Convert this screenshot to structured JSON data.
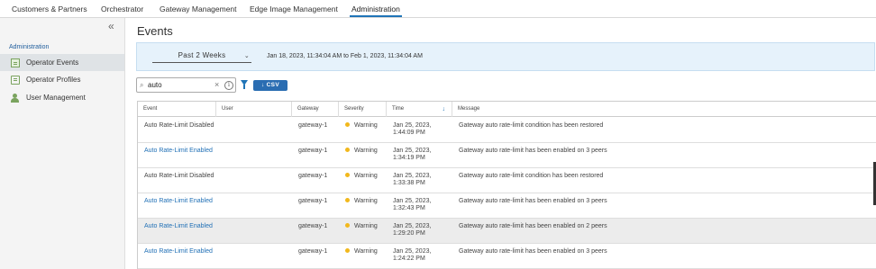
{
  "nav": {
    "tabs": [
      {
        "label": "Customers & Partners"
      },
      {
        "label": "Orchestrator"
      },
      {
        "label": "Gateway Management"
      },
      {
        "label": "Edge Image Management"
      },
      {
        "label": "Administration"
      }
    ],
    "active_tab": "Administration"
  },
  "sidebar": {
    "collapse_icon": "«",
    "section_label": "Administration",
    "items": [
      {
        "label": "Operator Events",
        "icon": "events-icon",
        "active": true
      },
      {
        "label": "Operator Profiles",
        "icon": "profiles-icon",
        "active": false
      },
      {
        "label": "User Management",
        "icon": "user-icon",
        "active": false
      }
    ]
  },
  "page": {
    "title": "Events"
  },
  "filter": {
    "range_value": "Past 2 Weeks",
    "range_chevron": "⌄",
    "range_text": "Jan 18, 2023, 11:34:04 AM to Feb 1, 2023, 11:34:04 AM"
  },
  "search": {
    "value": "auto",
    "clear_icon": "×",
    "info_icon": "i",
    "search_icon": "⌕"
  },
  "toolbar": {
    "csv_label": "↓ CSV"
  },
  "table": {
    "columns": [
      "Event",
      "User",
      "Gateway",
      "Severity",
      "Time",
      "Message"
    ],
    "sort_icon": "↓",
    "rows": [
      {
        "event": "Auto Rate-Limit Disabled",
        "user": "",
        "gateway": "gateway-1",
        "severity": "Warning",
        "time": "Jan 25, 2023, 1:44:09 PM",
        "message": "Gateway auto rate-limit condition has been restored",
        "link": false,
        "highlight": false
      },
      {
        "event": "Auto Rate-Limit Enabled",
        "user": "",
        "gateway": "gateway-1",
        "severity": "Warning",
        "time": "Jan 25, 2023, 1:34:19 PM",
        "message": "Gateway auto rate-limit has been enabled on 3 peers",
        "link": true,
        "highlight": false
      },
      {
        "event": "Auto Rate-Limit Disabled",
        "user": "",
        "gateway": "gateway-1",
        "severity": "Warning",
        "time": "Jan 25, 2023, 1:33:38 PM",
        "message": "Gateway auto rate-limit condition has been restored",
        "link": false,
        "highlight": false
      },
      {
        "event": "Auto Rate-Limit Enabled",
        "user": "",
        "gateway": "gateway-1",
        "severity": "Warning",
        "time": "Jan 25, 2023, 1:32:43 PM",
        "message": "Gateway auto rate-limit has been enabled on 3 peers",
        "link": true,
        "highlight": false
      },
      {
        "event": "Auto Rate-Limit Enabled",
        "user": "",
        "gateway": "gateway-1",
        "severity": "Warning",
        "time": "Jan 25, 2023, 1:29:20 PM",
        "message": "Gateway auto rate-limit has been enabled on 2 peers",
        "link": true,
        "highlight": true
      },
      {
        "event": "Auto Rate-Limit Enabled",
        "user": "",
        "gateway": "gateway-1",
        "severity": "Warning",
        "time": "Jan 25, 2023, 1:24:22 PM",
        "message": "Gateway auto rate-limit has been enabled on 3 peers",
        "link": true,
        "highlight": false
      }
    ]
  },
  "colors": {
    "accent": "#1f74b7",
    "warning": "#f2b81c",
    "link": "#1f6fb5"
  }
}
